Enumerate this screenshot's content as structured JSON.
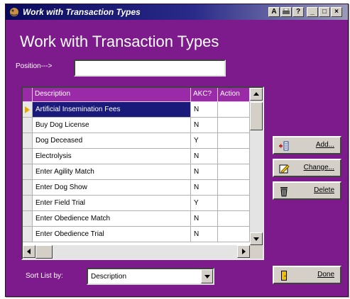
{
  "window": {
    "title": "Work with Transaction Types",
    "controls": [
      "A",
      "?",
      "_",
      "□",
      "×"
    ]
  },
  "heading": "Work with Transaction Types",
  "position": {
    "label": "Position--->",
    "value": ""
  },
  "grid": {
    "columns": [
      "Description",
      "AKC?",
      "Action"
    ],
    "rows": [
      {
        "description": "Artificial Insemination Fees",
        "akc": "N",
        "action": ""
      },
      {
        "description": "Buy Dog License",
        "akc": "N",
        "action": ""
      },
      {
        "description": "Dog Deceased",
        "akc": "Y",
        "action": ""
      },
      {
        "description": "Electrolysis",
        "akc": "N",
        "action": ""
      },
      {
        "description": "Enter Agility Match",
        "akc": "N",
        "action": ""
      },
      {
        "description": "Enter Dog Show",
        "akc": "N",
        "action": ""
      },
      {
        "description": "Enter Field Trial",
        "akc": "Y",
        "action": ""
      },
      {
        "description": "Enter Obedience Match",
        "akc": "N",
        "action": ""
      },
      {
        "description": "Enter Obedience Trial",
        "akc": "N",
        "action": ""
      }
    ],
    "selected_index": 0
  },
  "buttons": {
    "add": "Add...",
    "change": "Change...",
    "delete": "Delete",
    "done": "Done"
  },
  "sort": {
    "label": "Sort List by:",
    "value": "Description"
  },
  "colors": {
    "background": "#7d1a8c",
    "header": "#9a2aa8",
    "selection": "#1a1a7a",
    "titlebar": "#0a0a5c"
  }
}
